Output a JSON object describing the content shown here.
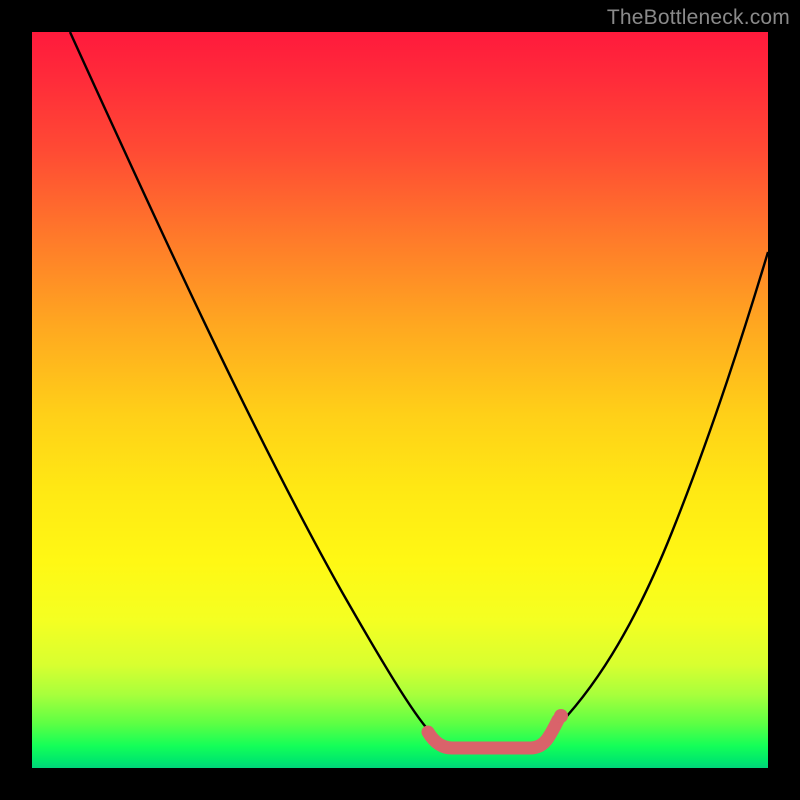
{
  "watermark": "TheBottleneck.com",
  "chart_data": {
    "type": "line",
    "title": "",
    "xlabel": "",
    "ylabel": "",
    "xlim": [
      0,
      100
    ],
    "ylim": [
      0,
      100
    ],
    "series": [
      {
        "name": "bottleneck-curve",
        "x": [
          0,
          10,
          20,
          30,
          40,
          47,
          52,
          55,
          60,
          65,
          70,
          80,
          90,
          100
        ],
        "values": [
          100,
          85,
          68,
          50,
          32,
          15,
          6,
          2,
          0,
          0,
          2,
          15,
          35,
          58
        ]
      }
    ],
    "annotations": [
      {
        "name": "optimal-zone",
        "x_start": 52,
        "x_end": 70,
        "style": "coral-highlight"
      }
    ],
    "background_gradient": {
      "top": "#ff1a3c",
      "middle": "#ffe814",
      "bottom": "#00e86c"
    }
  }
}
